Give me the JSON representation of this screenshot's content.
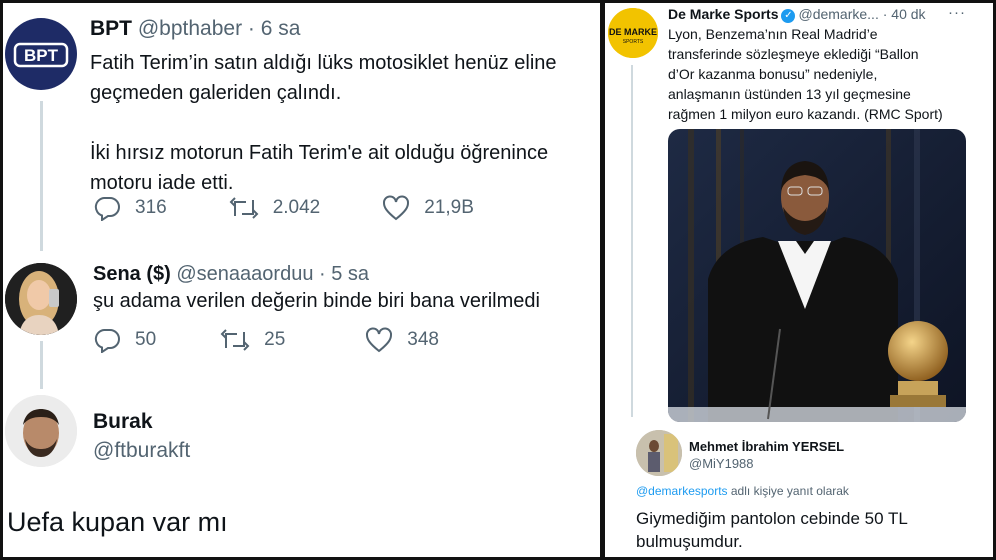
{
  "left": {
    "tweet1": {
      "name": "BPT",
      "handle": "@bpthaber",
      "time": "· 6 sa",
      "avatar_text": "BPT",
      "line1": "Fatih Terim’in satın aldığı lüks motosiklet henüz eline",
      "line2": "geçmeden galeriden çalındı.",
      "line3": "İki hırsız motorun Fatih Terim'e ait olduğu öğrenince",
      "line4": "motoru iade etti.",
      "replies": "316",
      "retweets": "2.042",
      "likes": "21,9B"
    },
    "tweet2": {
      "name": "Sena ($)",
      "handle": "@senaaaorduu",
      "time": "· 5 sa",
      "text": "şu adama verilen değerin binde biri bana verilmedi",
      "replies": "50",
      "retweets": "25",
      "likes": "348"
    },
    "tweet3": {
      "name": "Burak",
      "handle": "@ftburakft",
      "text": "Uefa kupan var mı"
    }
  },
  "right": {
    "tweet1": {
      "name": "De Marke Sports",
      "handle": "@demarke...",
      "time": "· 40 dk",
      "more": "···",
      "avatar_line1": "DE MARKE",
      "avatar_line2": "SPORTS",
      "line1": "Lyon, Benzema’nın Real Madrid’e",
      "line2": "transferinde sözleşmeye eklediği “Ballon",
      "line3": "d’Or kazanma bonusu” nedeniyle,",
      "line4": "anlaşmanın üstünden 13 yıl geçmesine",
      "line5": "rağmen 1 milyon euro kazandı. (RMC Sport)"
    },
    "reply": {
      "name": "Mehmet İbrahim YERSEL",
      "handle": "@MiY1988",
      "reply_to_handle": "@demarkesports",
      "reply_to_suffix": " adlı kişiye yanıt olarak",
      "line1": "Giymediğim pantolon cebinde 50 TL",
      "line2": "bulmuşumdur."
    }
  },
  "colors": {
    "text": "#0f1419",
    "muted": "#536471",
    "link": "#1d9bf0",
    "bpt_avatar": "#1e2b66",
    "demarke_yellow": "#f2c300"
  },
  "icons": [
    "reply-icon",
    "retweet-icon",
    "like-icon",
    "verified-badge-icon",
    "more-icon"
  ]
}
